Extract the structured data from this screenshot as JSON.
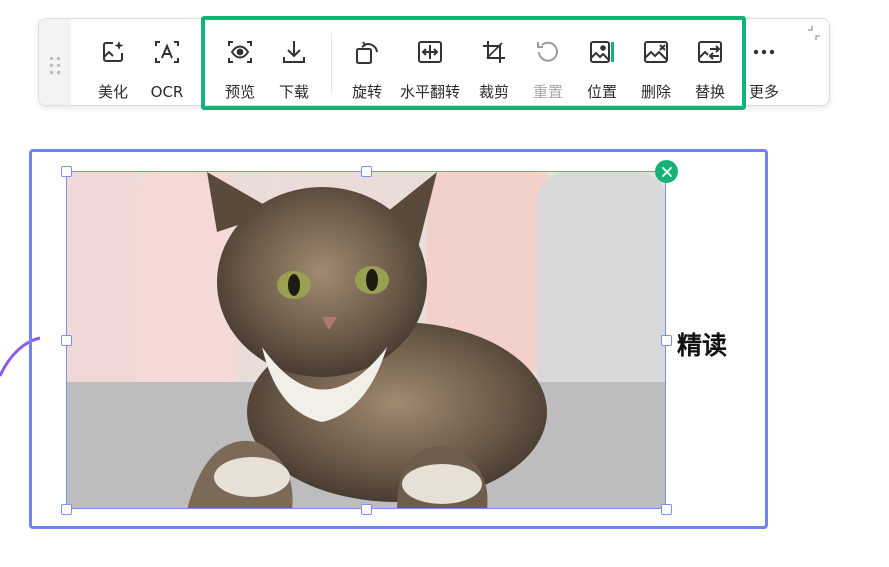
{
  "toolbar": {
    "items": [
      {
        "label": "美化",
        "icon": "beautify-icon"
      },
      {
        "label": "OCR",
        "icon": "ocr-icon"
      },
      {
        "label": "预览",
        "icon": "preview-eye-icon"
      },
      {
        "label": "下载",
        "icon": "download-icon"
      },
      {
        "label": "旋转",
        "icon": "rotate-icon"
      },
      {
        "label": "水平翻转",
        "icon": "flip-horizontal-icon"
      },
      {
        "label": "裁剪",
        "icon": "crop-icon"
      },
      {
        "label": "重置",
        "icon": "reset-icon",
        "disabled": true
      },
      {
        "label": "位置",
        "icon": "position-icon"
      },
      {
        "label": "删除",
        "icon": "delete-image-icon"
      },
      {
        "label": "替换",
        "icon": "replace-icon"
      },
      {
        "label": "更多",
        "icon": "more-dots-icon"
      }
    ],
    "highlight_color": "#14b277"
  },
  "canvas": {
    "side_text": "精读",
    "selection_color": "#6f84f0",
    "close_button_color": "#14b277"
  }
}
